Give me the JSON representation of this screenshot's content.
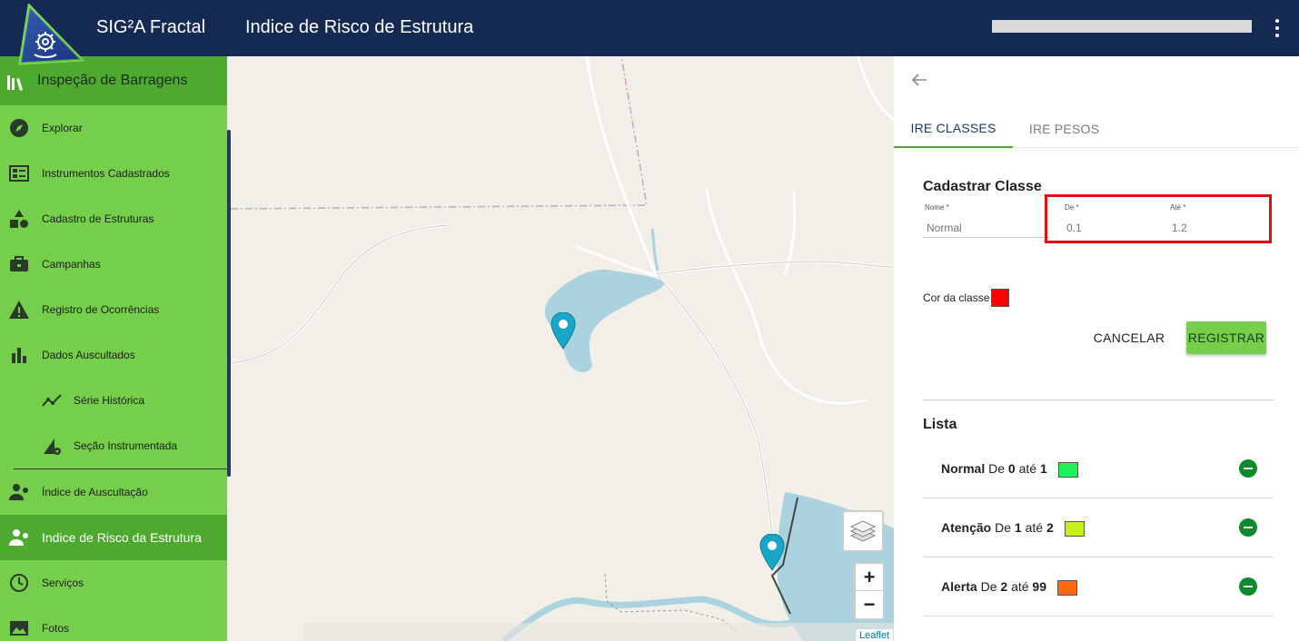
{
  "header": {
    "app_name": "SIG²A Fractal",
    "page_title": "Indice de Risco de Estrutura",
    "menu_icon": "more-vert-icon",
    "logo_icon": "gear-network-icon"
  },
  "sidebar": {
    "section_title": "Inspeção de Barragens",
    "items": [
      {
        "label": "Explorar",
        "icon": "compass-icon"
      },
      {
        "label": "Instrumentos Cadastrados",
        "icon": "dashboard-list-icon"
      },
      {
        "label": "Cadastro de Estruturas",
        "icon": "shapes-icon"
      },
      {
        "label": "Campanhas",
        "icon": "briefcase-icon"
      },
      {
        "label": "Registro de Ocorrências",
        "icon": "warning-icon"
      },
      {
        "label": "Dados Auscultados",
        "icon": "bar-chart-icon"
      },
      {
        "label": "Série Histórica",
        "icon": "trend-line-icon"
      },
      {
        "label": "Seção Instrumentada",
        "icon": "section-gear-icon"
      },
      {
        "label": "Índice de Auscultação",
        "icon": "person-gear-icon"
      },
      {
        "label": "Indice de Risco da Estrutura",
        "icon": "person-gear-icon"
      },
      {
        "label": "Serviços",
        "icon": "clock-icon"
      },
      {
        "label": "Fotos",
        "icon": "image-icon"
      }
    ],
    "active_item": "Indice de Risco da Estrutura",
    "colors": {
      "bg": "#76cf4a",
      "active": "#4daa2f"
    }
  },
  "map": {
    "attribution": "Leaflet",
    "zoom_in": "+",
    "zoom_out": "−",
    "layers_icon": "layers-icon",
    "marker_icon": "map-pin-icon"
  },
  "panel": {
    "back_icon": "arrow-left-icon",
    "tabs": [
      {
        "label": "IRE CLASSES",
        "active": true
      },
      {
        "label": "IRE PESOS",
        "active": false
      }
    ],
    "form": {
      "title": "Cadastrar Classe",
      "nome_label": "Nome *",
      "nome_placeholder": "Normal",
      "de_label": "De *",
      "de_placeholder": "0.1",
      "ate_label": "Até *",
      "ate_placeholder": "1.2",
      "cor_label": "Cor da classe",
      "cor_value": "#ff0000",
      "cancel_label": "CANCELAR",
      "register_label": "REGISTRAR"
    },
    "lista": {
      "title": "Lista",
      "de_word": "De",
      "ate_word": "até",
      "rows": [
        {
          "name": "Normal",
          "from": "0",
          "to": "1",
          "color": "#22f05a"
        },
        {
          "name": "Atenção",
          "from": "1",
          "to": "2",
          "color": "#c6f01a"
        },
        {
          "name": "Alerta",
          "from": "2",
          "to": "99",
          "color": "#ff6a10"
        }
      ],
      "remove_icon": "remove-circle-icon"
    }
  }
}
